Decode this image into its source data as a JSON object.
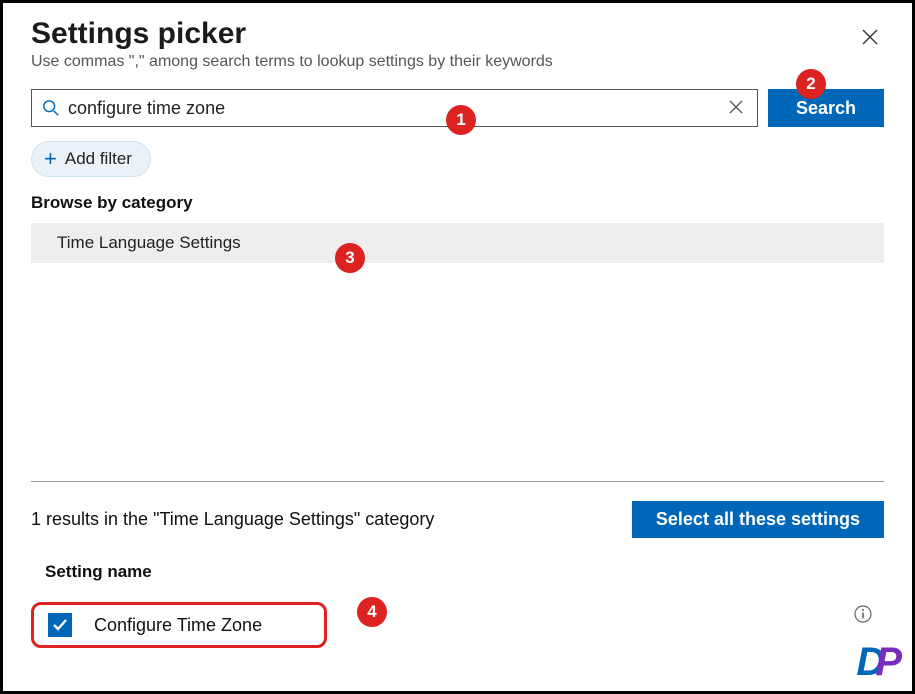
{
  "header": {
    "title": "Settings picker",
    "subtitle": "Use commas \",\" among search terms to lookup settings by their keywords"
  },
  "search": {
    "value": "configure time zone",
    "button": "Search"
  },
  "filter": {
    "add_label": "Add filter"
  },
  "browse": {
    "heading": "Browse by category",
    "category": "Time Language Settings"
  },
  "results": {
    "summary": "1 results in the \"Time Language Settings\" category",
    "select_all": "Select all these settings",
    "column_header": "Setting name",
    "items": [
      {
        "label": "Configure Time Zone",
        "checked": true
      }
    ]
  },
  "annotations": {
    "b1": "1",
    "b2": "2",
    "b3": "3",
    "b4": "4"
  }
}
